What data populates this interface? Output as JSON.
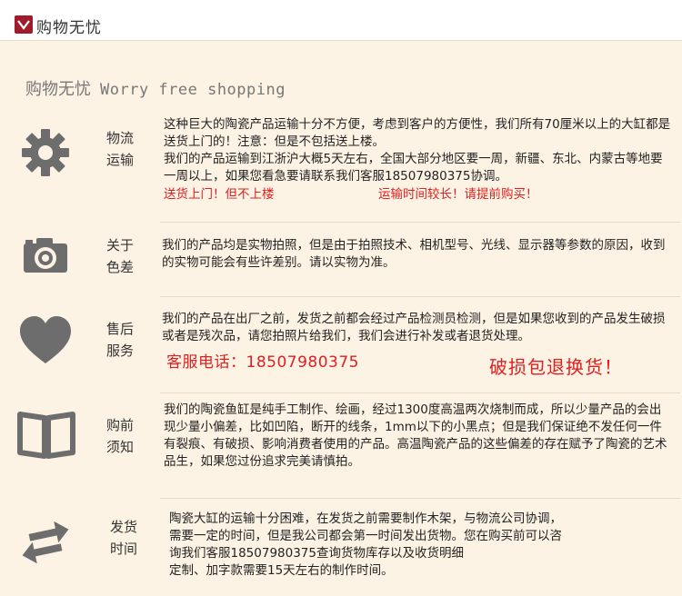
{
  "header": {
    "brand": "购物无忧"
  },
  "title": {
    "zh": "购物无忧",
    "en": "Worry free shopping"
  },
  "colors": {
    "accent_red": "#e02020",
    "icon_gray": "#6d6d6d",
    "background": "#fdf3e4"
  },
  "sections": [
    {
      "icon": "gear-icon",
      "label_1": "物流",
      "label_2": "运输",
      "paragraphs": [
        "这种巨大的陶瓷产品运输十分不方便，考虑到客户的方便性，我们所有70厘米以上的大缸都是送货上门的！注意：但是不包括送上楼。",
        "我们的产品运输到江浙沪大概5天左右，全国大部分地区要一周，新疆、东北、内蒙古等地要一周以上，如果您看急要请联系我们客服18507980375协调。"
      ],
      "notes": [
        "送货上门！但不上楼",
        "运输时间较长！请提前购买！"
      ]
    },
    {
      "icon": "camera-icon",
      "label_1": "关于",
      "label_2": "色差",
      "paragraphs": [
        "我们的产品均是实物拍照，但是由于拍照技术、相机型号、光线、显示器等参数的原因，收到的实物可能会有些许差别。请以实物为准。"
      ]
    },
    {
      "icon": "heart-icon",
      "label_1": "售后",
      "label_2": "服务",
      "paragraphs": [
        "我们的产品在出厂之前，发货之前都会经过产品检测员检测，但是如果您收到的产品发生破损或者是残次品，请您拍照片给我们，我们会进行补发或者退货处理。"
      ],
      "notes": [
        "客服电话：18507980375",
        "破损包退换货！"
      ]
    },
    {
      "icon": "book-icon",
      "label_1": "购前",
      "label_2": "须知",
      "paragraphs": [
        "我们的陶瓷鱼缸是纯手工制作、绘画，经过1300度高温两次烧制而成，所以少量产品的会出现少量小偏差，比如凹陷，断开的线条，1mm以下的小黑点；但是我们保证绝不发任何一件有裂痕、有破损、影响消费者使用的产品。高温陶瓷产品的这些偏差的存在赋予了陶瓷的艺术品生，如果您过份追求完美请慎拍。"
      ]
    },
    {
      "icon": "exchange-arrows-icon",
      "label_1": "发货",
      "label_2": "时间",
      "paragraphs": [
        "陶瓷大缸的运输十分困难，在发货之前需要制作木架，与物流公司协调，",
        "需要一定的时间，但是我公司都会第一时间发出货物。您在购买前可以咨",
        "询我们客服18507980375查询货物库存以及收货明细",
        "定制、加字款需要15天左右的制作时间。"
      ]
    }
  ]
}
